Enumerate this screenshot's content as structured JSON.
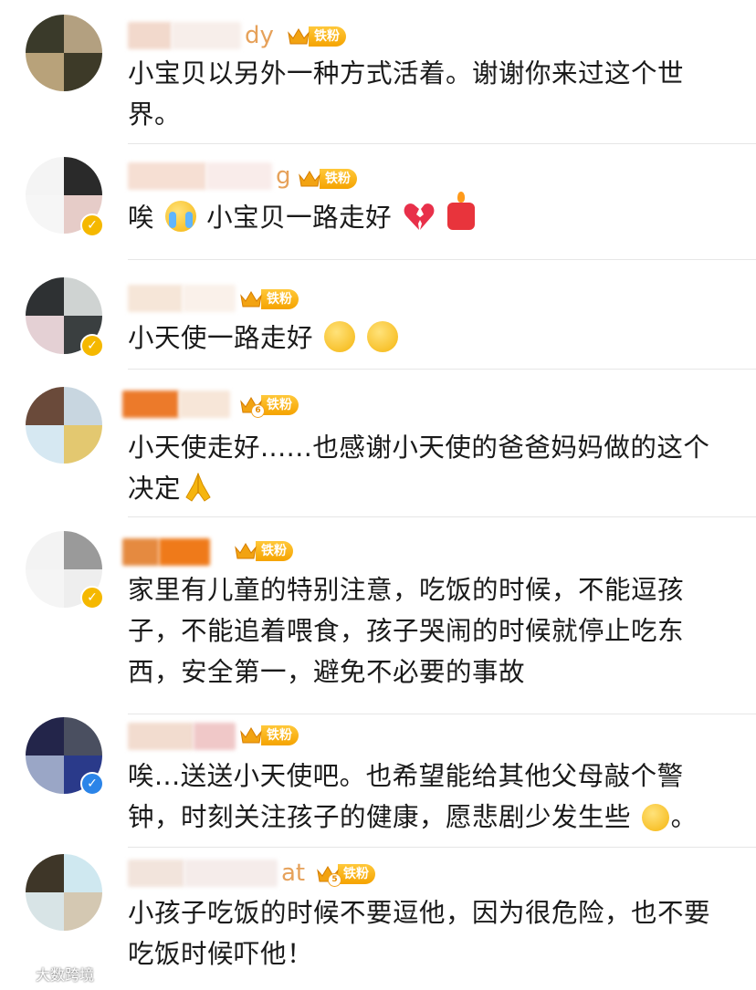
{
  "comments": [
    {
      "name_suffix": "dy",
      "badge_label": "铁粉",
      "badge_level": "",
      "text": "小宝贝以另外一种方式活着。谢谢你来过这个世界。",
      "avatar_colors": [
        "#3a3a2a",
        "#b3a080",
        "#b8a27a",
        "#3d3a28"
      ],
      "name_colors": [
        "#f2d9cc",
        "#f7eeea"
      ],
      "verified": "none"
    },
    {
      "name_suffix": "g",
      "badge_label": "铁粉",
      "badge_level": "",
      "text_parts": [
        "唉",
        "小宝贝一路走好"
      ],
      "avatar_colors": [
        "#f4f4f4",
        "#2a2a2a",
        "#f6f6f6",
        "#e6ccc8"
      ],
      "name_colors": [
        "#f6dfd3",
        "#f9ecea"
      ],
      "verified": "gold"
    },
    {
      "name_suffix": "",
      "badge_label": "铁粉",
      "badge_level": "",
      "text": "小天使一路走好",
      "avatar_colors": [
        "#2e3133",
        "#cfd3d2",
        "#e4d0d4",
        "#3a3f40"
      ],
      "name_colors": [
        "#f6e6d8",
        "#faf1ea"
      ],
      "verified": "gold"
    },
    {
      "name_suffix": "",
      "badge_label": "铁粉",
      "badge_level": "6",
      "text_line1": "小天使走好......也感谢小天使的爸爸妈妈做的这个",
      "text_line2": "决定",
      "avatar_colors": [
        "#6a4a3a",
        "#c8d6e0",
        "#d6e8f2",
        "#e3c870"
      ],
      "name_colors": [
        "#ec7a2a",
        "#f7e6d8"
      ],
      "verified": "none"
    },
    {
      "name_suffix": "",
      "badge_label": "铁粉",
      "badge_level": "",
      "text": "家里有儿童的特别注意，吃饭的时候，不能逗孩子，不能追着喂食，孩子哭闹的时候就停止吃东西，安全第一，避免不必要的事故",
      "avatar_colors": [
        "#f3f3f3",
        "#9a9a9a",
        "#f5f5f5",
        "#eeeeee"
      ],
      "name_colors": [
        "#e58a40",
        "#ef7a1a"
      ],
      "verified": "gold"
    },
    {
      "name_suffix": "",
      "badge_label": "铁粉",
      "badge_level": "",
      "text_parts": [
        "唉...送送小天使吧。也希望能给其他父母敲个警钟，时刻关注孩子的健康，愿悲剧少发生些",
        "。"
      ],
      "avatar_colors": [
        "#23254a",
        "#4a4f60",
        "#9aa6c6",
        "#2a3a8a"
      ],
      "name_colors": [
        "#f2dccf",
        "#f0c8c8"
      ],
      "verified": "blue"
    },
    {
      "name_suffix": "at",
      "badge_label": "铁粉",
      "badge_level": "5",
      "text": "小孩子吃饭的时候不要逗他，因为很危险，也不要吃饭时候吓他！",
      "avatar_colors": [
        "#3e3628",
        "#cfe8f0",
        "#d8e4e6",
        "#d4c8b2"
      ],
      "name_colors": [
        "#f2e4dc",
        "#f5ecea"
      ],
      "verified": "none"
    }
  ],
  "watermark": {
    "text": "大数跨境"
  }
}
